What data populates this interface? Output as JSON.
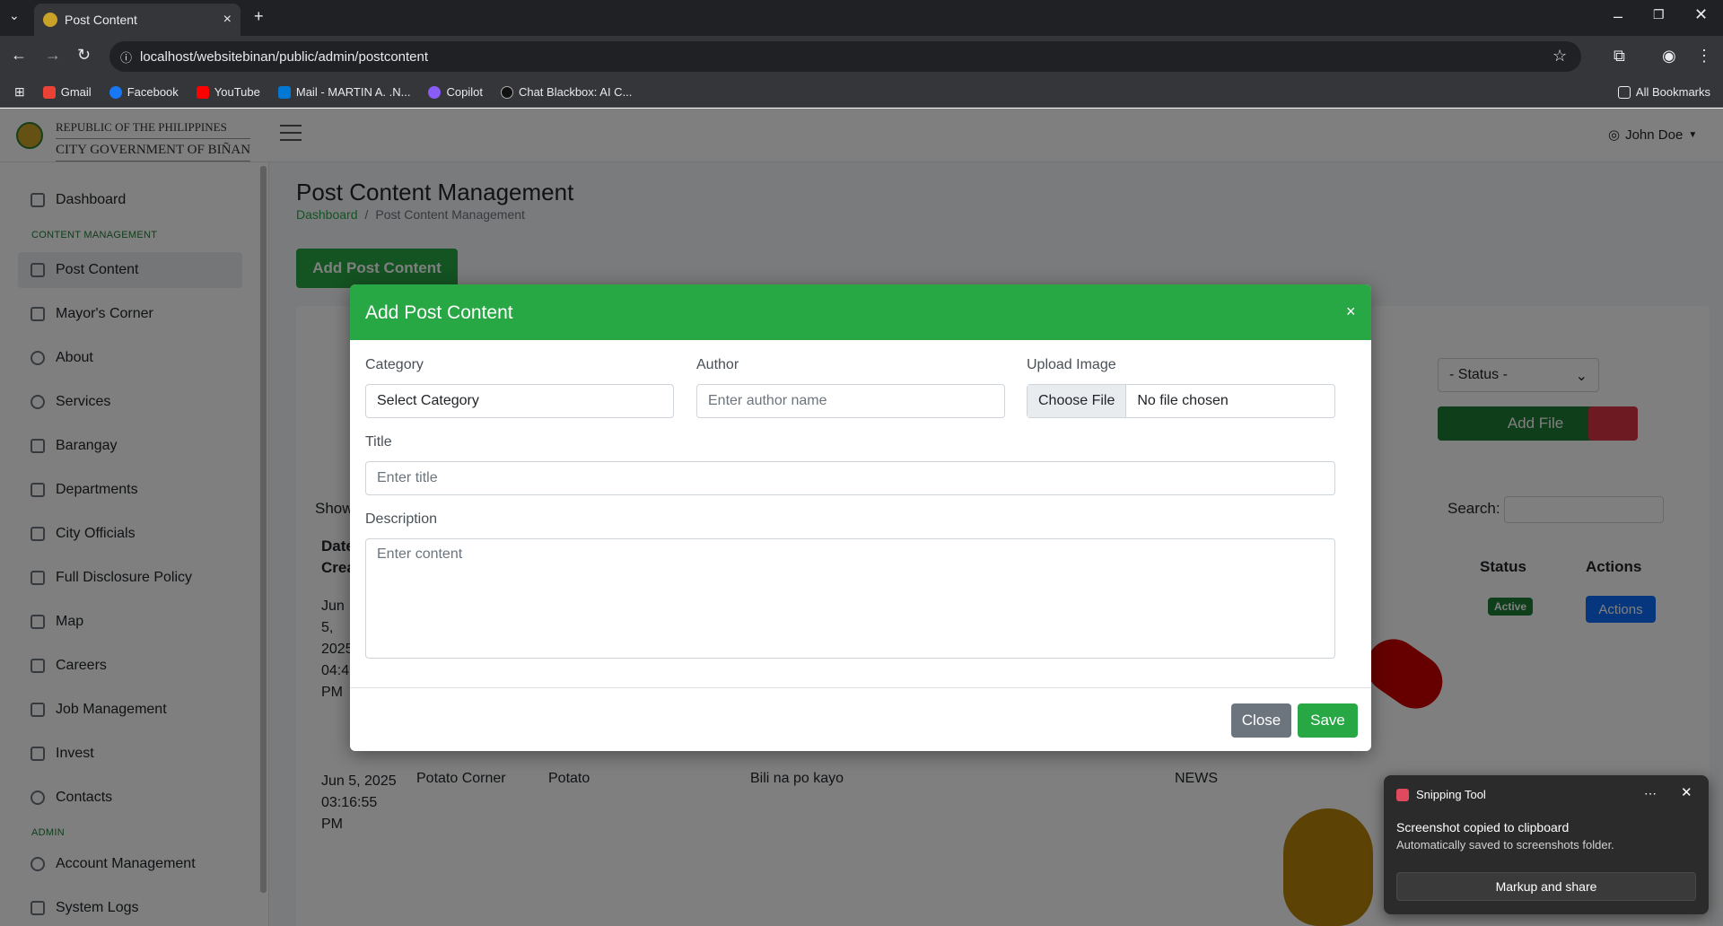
{
  "browser": {
    "tab_title": "Post Content",
    "url": "localhost/websitebinan/public/admin/postcontent",
    "bookmarks": [
      "Gmail",
      "Facebook",
      "YouTube",
      "Mail - MARTIN A. .N...",
      "Copilot",
      "Chat Blackbox: AI C..."
    ],
    "all_bookmarks": "All Bookmarks"
  },
  "header": {
    "line1": "REPUBLIC OF THE PHILIPPINES",
    "line2": "CITY GOVERNMENT OF BIÑAN",
    "user": "John Doe"
  },
  "sidebar": {
    "dashboard": "Dashboard",
    "section_content": "CONTENT MANAGEMENT",
    "items": [
      "Post Content",
      "Mayor's Corner",
      "About",
      "Services",
      "Barangay",
      "Departments",
      "City Officials",
      "Full Disclosure Policy",
      "Map",
      "Careers",
      "Job Management",
      "Invest",
      "Contacts"
    ],
    "section_admin": "ADMIN",
    "admin_items": [
      "Account Management",
      "System Logs"
    ]
  },
  "page": {
    "title": "Post Content Management",
    "breadcrumb_home": "Dashboard",
    "breadcrumb_sep": "/",
    "breadcrumb_current": "Post Content Management",
    "add_button": "Add Post Content",
    "status_select": "- Status -",
    "add_file": "Add File",
    "show_label": "Show",
    "search_label": "Search:",
    "col_date": "Date Created",
    "col_status": "Status",
    "col_actions": "Actions",
    "row1": {
      "date": "Jun 5, 2025 04:4 PM",
      "status": "Active",
      "actions": "Actions"
    },
    "row2": {
      "date": "Jun 5, 2025 03:16:55 PM",
      "author": "Potato Corner",
      "title": "Potato",
      "desc": "Bili na po kayo",
      "category": "NEWS"
    }
  },
  "modal": {
    "title": "Add Post Content",
    "close_x": "×",
    "category_label": "Category",
    "category_value": "Select Category",
    "author_label": "Author",
    "author_placeholder": "Enter author name",
    "upload_label": "Upload Image",
    "choose_file": "Choose File",
    "no_file": "No file chosen",
    "title_label": "Title",
    "title_placeholder": "Enter title",
    "description_label": "Description",
    "description_placeholder": "Enter content",
    "close_button": "Close",
    "save_button": "Save"
  },
  "toast": {
    "app": "Snipping Tool",
    "message": "Screenshot copied to clipboard",
    "sub": "Automatically saved to screenshots folder.",
    "action": "Markup and share"
  }
}
